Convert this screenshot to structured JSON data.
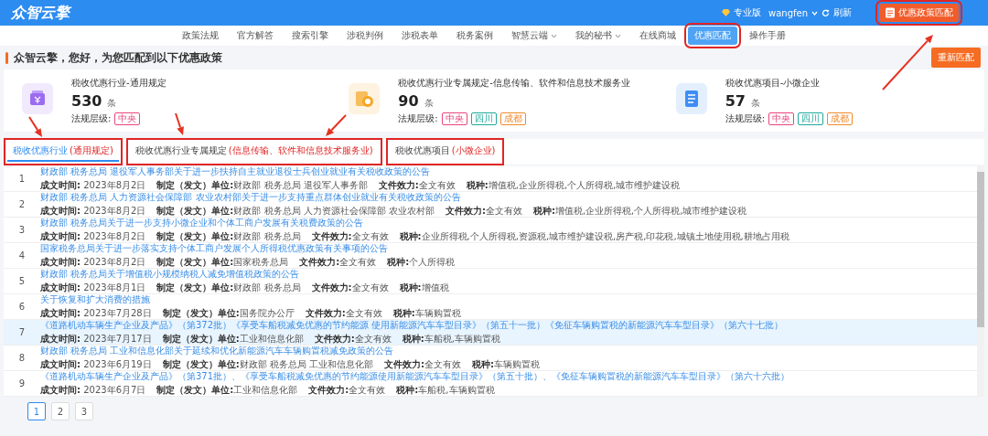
{
  "header": {
    "logo": "众智云擎",
    "edition": "专业版",
    "user": "wangfen",
    "refresh": "刷新",
    "match_button": {
      "label": "优惠政策匹配",
      "highlighted": true
    }
  },
  "nav": [
    {
      "label": "政策法规",
      "selected": false,
      "dropdown": false,
      "highlighted": false
    },
    {
      "label": "官方解答",
      "selected": false,
      "dropdown": false,
      "highlighted": false
    },
    {
      "label": "搜索引擎",
      "selected": false,
      "dropdown": false,
      "highlighted": false
    },
    {
      "label": "涉税判例",
      "selected": false,
      "dropdown": false,
      "highlighted": false
    },
    {
      "label": "涉税表单",
      "selected": false,
      "dropdown": false,
      "highlighted": false
    },
    {
      "label": "税务案例",
      "selected": false,
      "dropdown": false,
      "highlighted": false
    },
    {
      "label": "智慧云端",
      "selected": false,
      "dropdown": true,
      "highlighted": false
    },
    {
      "label": "我的秘书",
      "selected": false,
      "dropdown": true,
      "highlighted": false
    },
    {
      "label": "在线商城",
      "selected": false,
      "dropdown": false,
      "highlighted": false
    },
    {
      "label": "优惠匹配",
      "selected": true,
      "dropdown": false,
      "highlighted": true
    },
    {
      "label": "操作手册",
      "selected": false,
      "dropdown": false,
      "highlighted": false
    }
  ],
  "greeting": "众智云擎，您好，为您匹配到以下优惠政策",
  "rematch_button": "重新匹配",
  "cards": [
    {
      "title": "税收优惠行业-通用规定",
      "count": "530",
      "unit": "条",
      "level_label": "法规层级:",
      "color": "#9b6cf0",
      "tags": [
        {
          "label": "中央",
          "color": "#e8477f"
        }
      ]
    },
    {
      "title": "税收优惠行业专属规定-信息传输、软件和信息技术服务业",
      "count": "90",
      "unit": "条",
      "level_label": "法规层级:",
      "color": "#f5a623",
      "tags": [
        {
          "label": "中央",
          "color": "#e8477f"
        },
        {
          "label": "四川",
          "color": "#1fa99c"
        },
        {
          "label": "成都",
          "color": "#ef8a2b"
        }
      ]
    },
    {
      "title": "税收优惠项目-小微企业",
      "count": "57",
      "unit": "条",
      "level_label": "法规层级:",
      "color": "#3d8ef5",
      "tags": [
        {
          "label": "中央",
          "color": "#e8477f"
        },
        {
          "label": "四川",
          "color": "#1fa99c"
        },
        {
          "label": "成都",
          "color": "#ef8a2b"
        }
      ]
    }
  ],
  "tabs": [
    {
      "label": "税收优惠行业",
      "sub": "(通用规定)",
      "selected": true,
      "highlighted": true
    },
    {
      "label": "税收优惠行业专属规定",
      "sub": "(信息传输、软件和信息技术服务业)",
      "selected": false,
      "highlighted": true
    },
    {
      "label": "税收优惠项目",
      "sub": "(小微企业)",
      "selected": false,
      "highlighted": true
    }
  ],
  "rows": [
    {
      "index": "1",
      "selected": false,
      "title": "财政部 税务总局 退役军人事务部关于进一步扶持自主就业退役士兵创业就业有关税收政策的公告",
      "meta": [
        "**成文时间:** 2023年8月2日",
        "**制定（发文）单位:**财政部 税务总局 退役军人事务部",
        "**文件效力:**全文有效",
        "**税种:**增值税,企业所得税,个人所得税,城市维护建设税"
      ]
    },
    {
      "index": "2",
      "selected": false,
      "title": "财政部 税务总局 人力资源社会保障部 农业农村部关于进一步支持重点群体创业就业有关税收政策的公告",
      "meta": [
        "**成文时间:** 2023年8月2日",
        "**制定（发文）单位:**财政部 税务总局 人力资源社会保障部 农业农村部",
        "**文件效力:**全文有效",
        "**税种:**增值税,企业所得税,个人所得税,城市维护建设税"
      ]
    },
    {
      "index": "3",
      "selected": false,
      "title": "财政部 税务总局关于进一步支持小微企业和个体工商户发展有关税费政策的公告",
      "meta": [
        "**成文时间:** 2023年8月2日",
        "**制定（发文）单位:**财政部 税务总局",
        "**文件效力:**全文有效",
        "**税种:**企业所得税,个人所得税,资源税,城市维护建设税,房产税,印花税,城镇土地使用税,耕地占用税"
      ]
    },
    {
      "index": "4",
      "selected": false,
      "title": "国家税务总局关于进一步落实支持个体工商户发展个人所得税优惠政策有关事项的公告",
      "meta": [
        "**成文时间:** 2023年8月2日",
        "**制定（发文）单位:**国家税务总局",
        "**文件效力:**全文有效",
        "**税种:**个人所得税"
      ]
    },
    {
      "index": "5",
      "selected": false,
      "title": "财政部 税务总局关于增值税小规模纳税人减免增值税政策的公告",
      "meta": [
        "**成文时间:** 2023年8月1日",
        "**制定（发文）单位:**财政部 税务总局",
        "**文件效力:**全文有效",
        "**税种:**增值税"
      ]
    },
    {
      "index": "6",
      "selected": false,
      "title": "关于恢复和扩大消费的措施",
      "meta": [
        "**成文时间:** 2023年7月28日",
        "**制定（发文）单位:**国务院办公厅",
        "**文件效力:**全文有效",
        "**税种:**车辆购置税"
      ]
    },
    {
      "index": "7",
      "selected": true,
      "title": "《道路机动车辆生产企业及产品》（第372批）《享受车船税减免优惠的节约能源 使用新能源汽车车型目录》（第五十一批）《免征车辆购置税的新能源汽车车型目录》（第六十七批）",
      "meta": [
        "**成文时间:** 2023年7月17日",
        "**制定（发文）单位:**工业和信息化部",
        "**文件效力:**全文有效",
        "**税种:**车船税,车辆购置税"
      ]
    },
    {
      "index": "8",
      "selected": false,
      "title": "财政部 税务总局 工业和信息化部关于延续和优化新能源汽车车辆购置税减免政策的公告",
      "meta": [
        "**成文时间:** 2023年6月19日",
        "**制定（发文）单位:**财政部 税务总局 工业和信息化部",
        "**文件效力:**全文有效",
        "**税种:**车辆购置税"
      ]
    },
    {
      "index": "9",
      "selected": false,
      "title": "《道路机动车辆生产企业及产品》（第371批）、《享受车船税减免优惠的节约能源使用新能源汽车车型目录》（第五十批）、《免征车辆购置税的新能源汽车车型目录》（第六十六批）",
      "meta": [
        "**成文时间:** 2023年6月7日",
        "**制定（发文）单位:**工业和信息化部",
        "**文件效力:**全文有效",
        "**税种:**车船税,车辆购置税"
      ]
    }
  ],
  "pagination": [
    {
      "label": "1",
      "selected": true
    },
    {
      "label": "2",
      "selected": false
    },
    {
      "label": "3",
      "selected": false
    }
  ]
}
